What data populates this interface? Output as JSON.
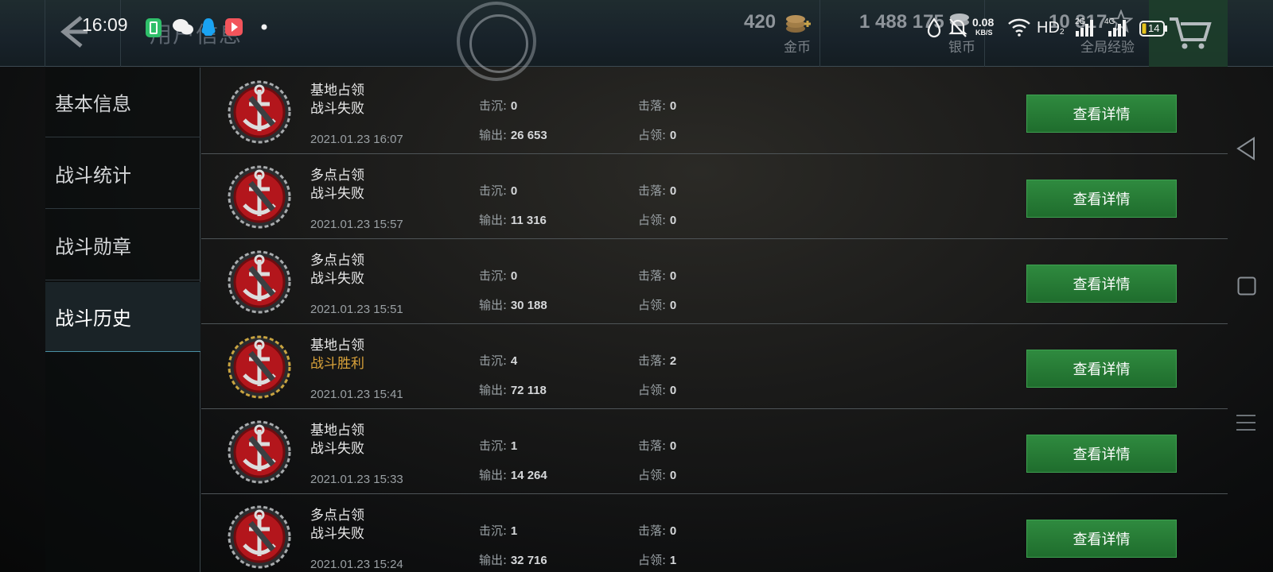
{
  "status_bar": {
    "time": "16:09",
    "net_speed_value": "0.08",
    "net_speed_unit": "KB/S",
    "hd_label": "HD",
    "hd_sub": "2",
    "sim1_label": "2G",
    "sim2_label": "4G",
    "battery": "14"
  },
  "header": {
    "title": "用户信息",
    "currencies": [
      {
        "value": "420",
        "label": "金币"
      },
      {
        "value": "1 488 175",
        "label": "银币"
      },
      {
        "value": "10 817",
        "label": "全局经验"
      }
    ]
  },
  "sidebar": {
    "items": [
      {
        "label": "基本信息",
        "active": false
      },
      {
        "label": "战斗统计",
        "active": false
      },
      {
        "label": "战斗勋章",
        "active": false
      },
      {
        "label": "战斗历史",
        "active": true
      }
    ]
  },
  "labels": {
    "sunk": "击沉:",
    "downed": "击落:",
    "damage": "输出:",
    "capture": "占领:",
    "details_button": "查看详情"
  },
  "battles": [
    {
      "mode": "基地占领",
      "result": "战斗失败",
      "win": false,
      "date": "2021.01.23 16:07",
      "sunk": "0",
      "downed": "0",
      "damage": "26 653",
      "capture": "0"
    },
    {
      "mode": "多点占领",
      "result": "战斗失败",
      "win": false,
      "date": "2021.01.23 15:57",
      "sunk": "0",
      "downed": "0",
      "damage": "11 316",
      "capture": "0"
    },
    {
      "mode": "多点占领",
      "result": "战斗失败",
      "win": false,
      "date": "2021.01.23 15:51",
      "sunk": "0",
      "downed": "0",
      "damage": "30 188",
      "capture": "0"
    },
    {
      "mode": "基地占领",
      "result": "战斗胜利",
      "win": true,
      "date": "2021.01.23 15:41",
      "sunk": "4",
      "downed": "2",
      "damage": "72 118",
      "capture": "0"
    },
    {
      "mode": "基地占领",
      "result": "战斗失败",
      "win": false,
      "date": "2021.01.23 15:33",
      "sunk": "1",
      "downed": "0",
      "damage": "14 264",
      "capture": "0"
    },
    {
      "mode": "多点占领",
      "result": "战斗失败",
      "win": false,
      "date": "2021.01.23 15:24",
      "sunk": "1",
      "downed": "0",
      "damage": "32 716",
      "capture": "1"
    }
  ],
  "colors": {
    "button_green": "#2f8a3f",
    "win_gold": "#d9a23a",
    "active_underline": "#4a8fa4"
  }
}
